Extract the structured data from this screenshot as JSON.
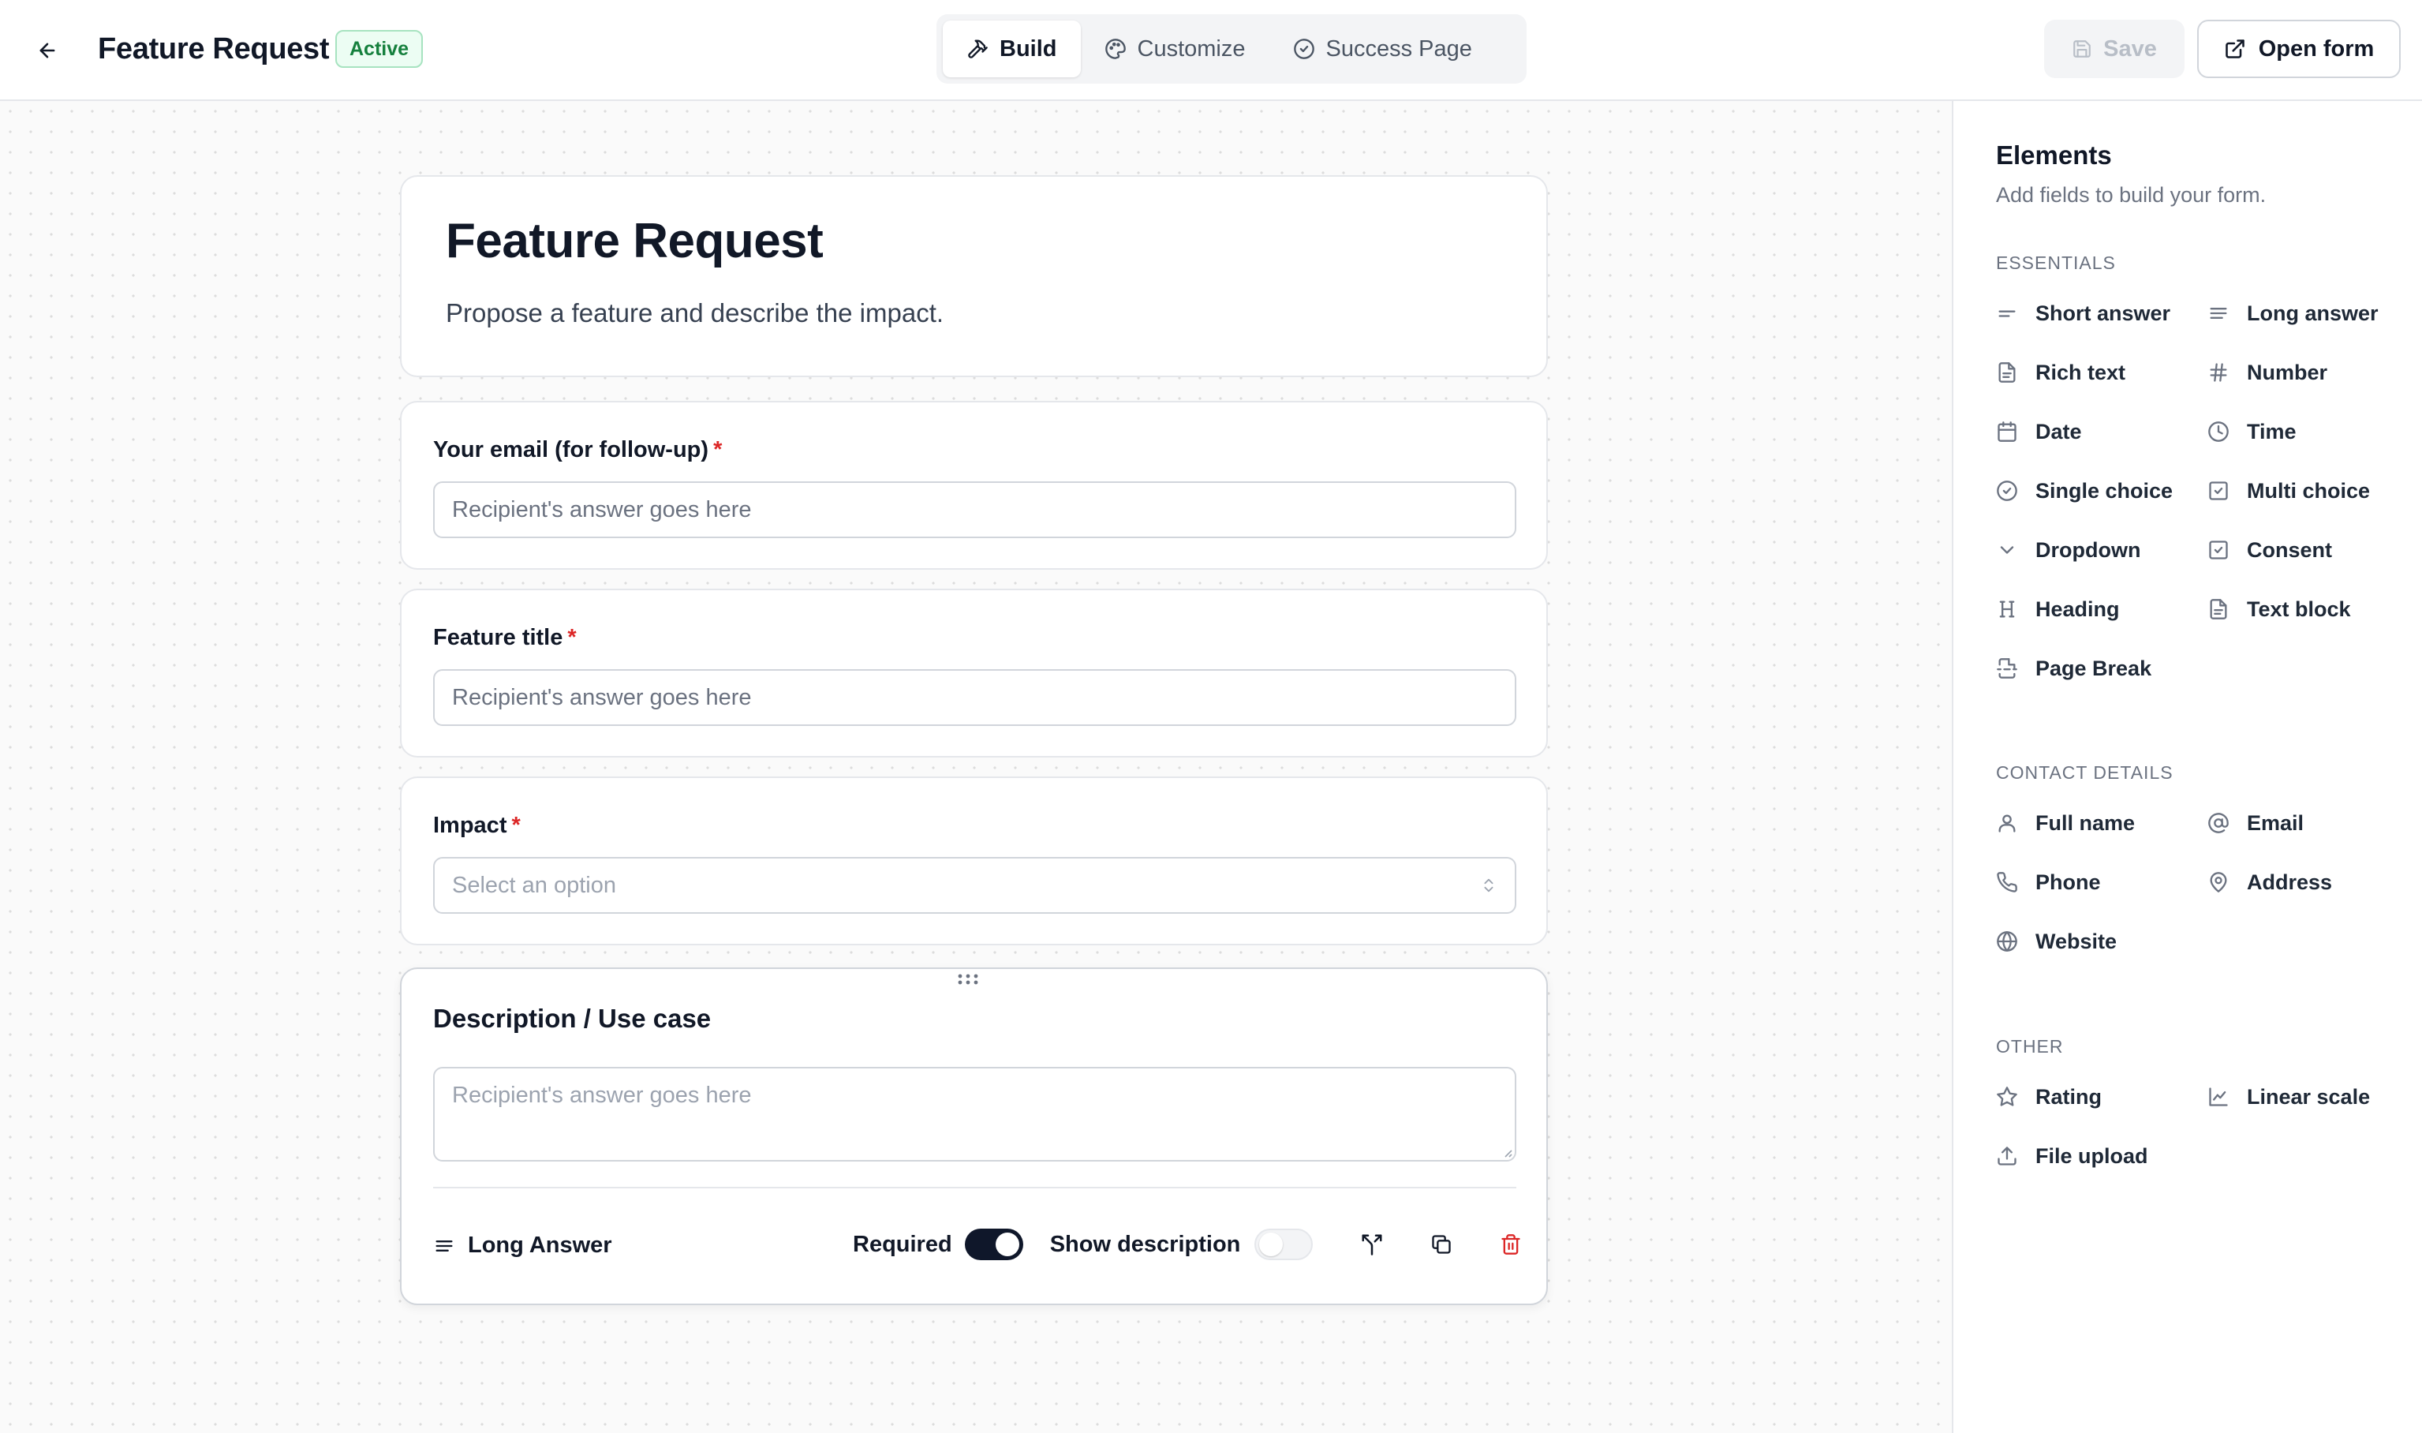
{
  "header": {
    "title": "Feature Request",
    "status": "Active",
    "tabs": [
      {
        "label": "Build",
        "icon": "hammer-icon",
        "active": true
      },
      {
        "label": "Customize",
        "icon": "palette-icon",
        "active": false
      },
      {
        "label": "Success Page",
        "icon": "check-circle-icon",
        "active": false
      }
    ],
    "save_label": "Save",
    "open_form_label": "Open form"
  },
  "form": {
    "title": "Feature Request",
    "description": "Propose a feature and describe the impact.",
    "fields": [
      {
        "label": "Your email (for follow-up)",
        "required": true,
        "placeholder": "Recipient's answer goes here"
      },
      {
        "label": "Feature title",
        "required": true,
        "placeholder": "Recipient's answer goes here"
      },
      {
        "label": "Impact",
        "required": true,
        "placeholder": "Select an option"
      }
    ],
    "selected_field": {
      "label": "Description / Use case",
      "placeholder": "Recipient's answer goes here",
      "type_label": "Long Answer",
      "required_label": "Required",
      "required_on": true,
      "show_description_label": "Show description",
      "show_description_on": false
    },
    "required_marker": "*"
  },
  "sidebar": {
    "title": "Elements",
    "subtitle": "Add fields to build your form.",
    "sections": [
      {
        "label": "ESSENTIALS",
        "items": [
          "Short answer",
          "Long answer",
          "Rich text",
          "Number",
          "Date",
          "Time",
          "Single choice",
          "Multi choice",
          "Dropdown",
          "Consent",
          "Heading",
          "Text block",
          "Page Break"
        ]
      },
      {
        "label": "CONTACT DETAILS",
        "items": [
          "Full name",
          "Email",
          "Phone",
          "Address",
          "Website"
        ]
      },
      {
        "label": "OTHER",
        "items": [
          "Rating",
          "Linear scale",
          "File upload"
        ]
      }
    ]
  },
  "colors": {
    "accent": "#0f172a",
    "active_badge": "#15803d",
    "required": "#dc2626",
    "delete": "#dc2626"
  }
}
